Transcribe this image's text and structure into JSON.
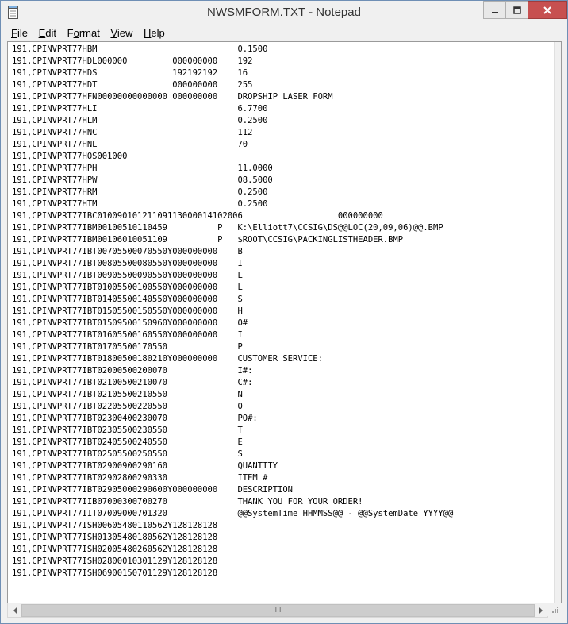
{
  "window": {
    "title": "NWSMFORM.TXT - Notepad"
  },
  "titlebar_icons": {
    "app": "notepad-icon",
    "minimize": "minimize-icon",
    "maximize": "maximize-icon",
    "close": "close-icon"
  },
  "menu": [
    {
      "label": "File",
      "key": "F",
      "rest": "ile"
    },
    {
      "label": "Edit",
      "key": "E",
      "rest": "dit"
    },
    {
      "label": "Format",
      "key": "o",
      "pre": "F",
      "rest": "rmat"
    },
    {
      "label": "View",
      "key": "V",
      "rest": "iew"
    },
    {
      "label": "Help",
      "key": "H",
      "rest": "elp"
    }
  ],
  "document": {
    "text": "191,CPINVPRT77HBM                            0.1500\n191,CPINVPRT77HDL000000         000000000    192\n191,CPINVPRT77HDS               192192192    16\n191,CPINVPRT77HDT               000000000    255\n191,CPINVPRT77HFN00000000000000 000000000    DROPSHIP LASER FORM\n191,CPINVPRT77HLI                            6.7700\n191,CPINVPRT77HLM                            0.2500\n191,CPINVPRT77HNC                            112\n191,CPINVPRT77HNL                            70\n191,CPINVPRT77HOS001000\n191,CPINVPRT77HPH                            11.0000\n191,CPINVPRT77HPW                            08.5000\n191,CPINVPRT77HRM                            0.2500\n191,CPINVPRT77HTM                            0.2500\n191,CPINVPRT77IBC01009010121109113000014102006                   000000000\n191,CPINVPRT77IBM00100510110459          P   K:\\Elliott7\\CCSIG\\DS@@LOC(20,09,06)@@.BMP\n191,CPINVPRT77IBM00106010051109          P   $ROOT\\CCSIG\\PACKINGLISTHEADER.BMP\n191,CPINVPRT77IBT00705500070550Y000000000    B\n191,CPINVPRT77IBT00805500080550Y000000000    I\n191,CPINVPRT77IBT00905500090550Y000000000    L\n191,CPINVPRT77IBT01005500100550Y000000000    L\n191,CPINVPRT77IBT01405500140550Y000000000    S\n191,CPINVPRT77IBT01505500150550Y000000000    H\n191,CPINVPRT77IBT01509500150960Y000000000    O#\n191,CPINVPRT77IBT01605500160550Y000000000    I\n191,CPINVPRT77IBT01705500170550              P\n191,CPINVPRT77IBT01800500180210Y000000000    CUSTOMER SERVICE:\n191,CPINVPRT77IBT02000500200070              I#:\n191,CPINVPRT77IBT02100500210070              C#:\n191,CPINVPRT77IBT02105500210550              N\n191,CPINVPRT77IBT02205500220550              O\n191,CPINVPRT77IBT02300400230070              PO#:\n191,CPINVPRT77IBT02305500230550              T\n191,CPINVPRT77IBT02405500240550              E\n191,CPINVPRT77IBT02505500250550              S\n191,CPINVPRT77IBT02900900290160              QUANTITY\n191,CPINVPRT77IBT02902800290330              ITEM #\n191,CPINVPRT77IBT02905000290600Y000000000    DESCRIPTION\n191,CPINVPRT77IIB07000300700270              THANK YOU FOR YOUR ORDER!\n191,CPINVPRT77IIT07009000701320              @@SystemTime_HHMMSS@@ - @@SystemDate_YYYY@@\n191,CPINVPRT77ISH00605480110562Y128128128\n191,CPINVPRT77ISH01305480180562Y128128128\n191,CPINVPRT77ISH02005480260562Y128128128\n191,CPINVPRT77ISH02800010301129Y128128128\n191,CPINVPRT77ISH06900150701129Y128128128"
  },
  "scrollbar": {
    "thumb_grip": "III",
    "left_arrow": "left-arrow-icon",
    "right_arrow": "right-arrow-icon"
  },
  "colors": {
    "close_button": "#c75050",
    "window_border": "#6f8fb5"
  }
}
